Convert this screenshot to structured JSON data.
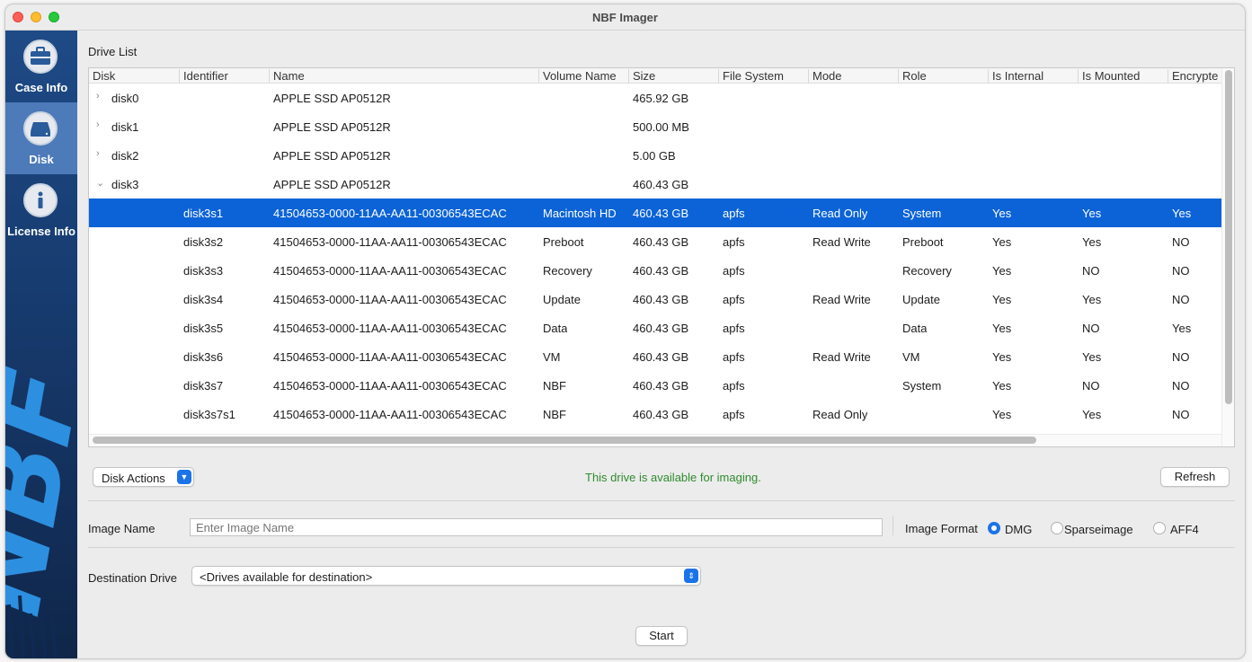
{
  "window": {
    "title": "NBF Imager"
  },
  "sidebar": {
    "items": [
      {
        "label": "Case Info",
        "icon": "briefcase-icon",
        "active": false
      },
      {
        "label": "Disk",
        "icon": "disk-drive-icon",
        "active": true
      },
      {
        "label": "License Info",
        "icon": "info-icon",
        "active": false
      }
    ],
    "logo_text": "NBF"
  },
  "drive_list": {
    "label": "Drive List",
    "columns": [
      "Disk",
      "Identifier",
      "Name",
      "Volume Name",
      "Size",
      "File System",
      "Mode",
      "Role",
      "Is Internal",
      "Is Mounted",
      "Encrypte"
    ],
    "rows": [
      {
        "disk": "disk0",
        "identifier": "",
        "name": "APPLE SSD AP0512R",
        "volume": "",
        "size": "465.92 GB",
        "fs": "",
        "mode": "",
        "role": "",
        "internal": "",
        "mounted": "",
        "encrypted": "",
        "chevron": "›"
      },
      {
        "disk": "disk1",
        "identifier": "",
        "name": "APPLE SSD AP0512R",
        "volume": "",
        "size": "500.00 MB",
        "fs": "",
        "mode": "",
        "role": "",
        "internal": "",
        "mounted": "",
        "encrypted": "",
        "chevron": "›"
      },
      {
        "disk": "disk2",
        "identifier": "",
        "name": "APPLE SSD AP0512R",
        "volume": "",
        "size": "5.00 GB",
        "fs": "",
        "mode": "",
        "role": "",
        "internal": "",
        "mounted": "",
        "encrypted": "",
        "chevron": "›"
      },
      {
        "disk": "disk3",
        "identifier": "",
        "name": "APPLE SSD AP0512R",
        "volume": "",
        "size": "460.43 GB",
        "fs": "",
        "mode": "",
        "role": "",
        "internal": "",
        "mounted": "",
        "encrypted": "",
        "chevron": "⌄"
      },
      {
        "disk": "",
        "identifier": "disk3s1",
        "name": "41504653-0000-11AA-AA11-00306543ECAC",
        "volume": "Macintosh HD",
        "size": "460.43 GB",
        "fs": "apfs",
        "mode": "Read Only",
        "role": "System",
        "internal": "Yes",
        "mounted": "Yes",
        "encrypted": "Yes",
        "chevron": ""
      },
      {
        "disk": "",
        "identifier": "disk3s2",
        "name": "41504653-0000-11AA-AA11-00306543ECAC",
        "volume": "Preboot",
        "size": "460.43 GB",
        "fs": "apfs",
        "mode": "Read Write",
        "role": "Preboot",
        "internal": "Yes",
        "mounted": "Yes",
        "encrypted": "NO",
        "chevron": ""
      },
      {
        "disk": "",
        "identifier": "disk3s3",
        "name": "41504653-0000-11AA-AA11-00306543ECAC",
        "volume": "Recovery",
        "size": "460.43 GB",
        "fs": "apfs",
        "mode": "",
        "role": "Recovery",
        "internal": "Yes",
        "mounted": "NO",
        "encrypted": "NO",
        "chevron": ""
      },
      {
        "disk": "",
        "identifier": "disk3s4",
        "name": "41504653-0000-11AA-AA11-00306543ECAC",
        "volume": "Update",
        "size": "460.43 GB",
        "fs": "apfs",
        "mode": "Read Write",
        "role": "Update",
        "internal": "Yes",
        "mounted": "Yes",
        "encrypted": "NO",
        "chevron": ""
      },
      {
        "disk": "",
        "identifier": "disk3s5",
        "name": "41504653-0000-11AA-AA11-00306543ECAC",
        "volume": "Data",
        "size": "460.43 GB",
        "fs": "apfs",
        "mode": "",
        "role": "Data",
        "internal": "Yes",
        "mounted": "NO",
        "encrypted": "Yes",
        "chevron": ""
      },
      {
        "disk": "",
        "identifier": "disk3s6",
        "name": "41504653-0000-11AA-AA11-00306543ECAC",
        "volume": "VM",
        "size": "460.43 GB",
        "fs": "apfs",
        "mode": "Read Write",
        "role": "VM",
        "internal": "Yes",
        "mounted": "Yes",
        "encrypted": "NO",
        "chevron": ""
      },
      {
        "disk": "",
        "identifier": "disk3s7",
        "name": "41504653-0000-11AA-AA11-00306543ECAC",
        "volume": "NBF",
        "size": "460.43 GB",
        "fs": "apfs",
        "mode": "",
        "role": "System",
        "internal": "Yes",
        "mounted": "NO",
        "encrypted": "NO",
        "chevron": ""
      },
      {
        "disk": "",
        "identifier": "disk3s7s1",
        "name": "41504653-0000-11AA-AA11-00306543ECAC",
        "volume": "NBF",
        "size": "460.43 GB",
        "fs": "apfs",
        "mode": "Read Only",
        "role": "",
        "internal": "Yes",
        "mounted": "Yes",
        "encrypted": "NO",
        "chevron": ""
      }
    ],
    "selected_index": 4
  },
  "actions": {
    "disk_actions_label": "Disk Actions",
    "status": "This drive is available for imaging.",
    "refresh_label": "Refresh"
  },
  "image": {
    "name_label": "Image Name",
    "name_placeholder": "Enter Image Name",
    "format_label": "Image Format",
    "formats": [
      {
        "label": "DMG",
        "selected": true
      },
      {
        "label": "Sparseimage",
        "selected": false
      },
      {
        "label": "AFF4",
        "selected": false
      }
    ]
  },
  "destination": {
    "label": "Destination Drive",
    "selected": "<Drives available for destination>"
  },
  "start_label": "Start",
  "colors": {
    "selection": "#0b63d7",
    "status_green": "#2e8b2e",
    "accent": "#1a73e8",
    "sidebar": "#1e4a86"
  }
}
